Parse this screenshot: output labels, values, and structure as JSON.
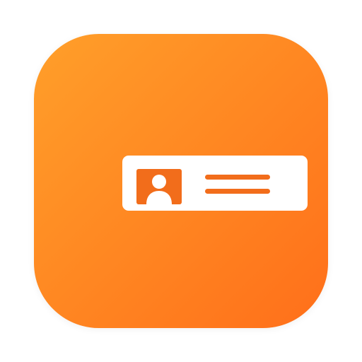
{
  "icon": {
    "name": "contact-card-app-icon",
    "gradient_start": "#FF9F2A",
    "gradient_end": "#FF6F1A",
    "card_color": "#FFFFFF",
    "accent": "#F26D1B",
    "glyphs": {
      "avatar": "user-avatar-icon",
      "text_lines": "text-lines-icon"
    }
  }
}
